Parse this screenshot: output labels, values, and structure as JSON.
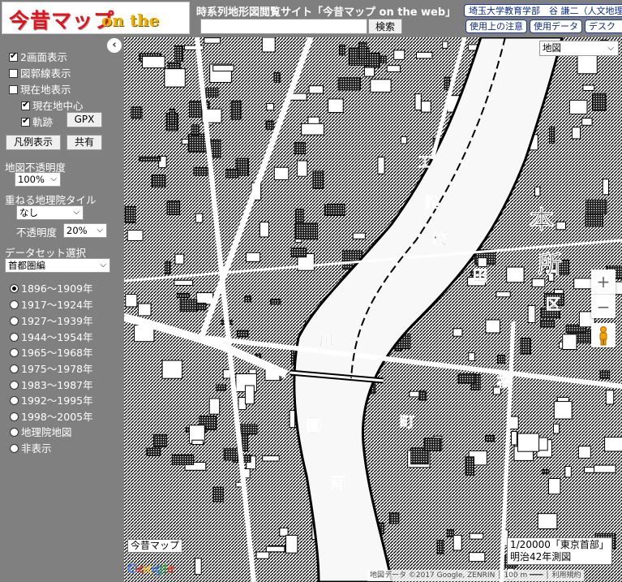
{
  "header": {
    "logo_jp": "今昔マップ",
    "logo_en": "on the web",
    "site_title": "時系列地形図閲覧サイト「今昔マップ on the web」",
    "search_placeholder": "",
    "search_button": "検索",
    "affiliation": "埼玉大学教育学部　谷 謙二（人文地理",
    "links": [
      "使用上の注意",
      "使用データ",
      "デスク"
    ]
  },
  "sidebar": {
    "collapse_icon": "chevron-left-icon",
    "checkboxes": [
      {
        "label": "2画面表示",
        "checked": true
      },
      {
        "label": "図郭線表示",
        "checked": false
      },
      {
        "label": "現在地表示",
        "checked": false
      },
      {
        "label": "現在地中心",
        "checked": true
      },
      {
        "label": "軌跡",
        "checked": true
      }
    ],
    "gpx_button": "GPX",
    "legend_button": "凡例表示",
    "share_button": "共有",
    "opacity_label": "地図不透明度",
    "opacity_value": "100%",
    "overlay_label": "重ねる地理院タイル",
    "overlay_value": "なし",
    "overlay_opacity_label": "不透明度",
    "overlay_opacity_value": "20%",
    "dataset_label": "データセット選択",
    "dataset_value": "首都圏編",
    "periods": [
      {
        "label": "1896～1909年",
        "checked": true
      },
      {
        "label": "1917～1924年",
        "checked": false
      },
      {
        "label": "1927～1939年",
        "checked": false
      },
      {
        "label": "1944～1954年",
        "checked": false
      },
      {
        "label": "1965～1968年",
        "checked": false
      },
      {
        "label": "1975～1978年",
        "checked": false
      },
      {
        "label": "1983～1987年",
        "checked": false
      },
      {
        "label": "1992～1995年",
        "checked": false
      },
      {
        "label": "1998～2005年",
        "checked": false
      },
      {
        "label": "地理院地図",
        "checked": false
      },
      {
        "label": "非表示",
        "checked": false
      }
    ]
  },
  "map": {
    "layer_select": "地図",
    "zoom_in": "+",
    "zoom_out": "−",
    "pegman_icon": "pegman-icon",
    "source_label": "今昔マップ",
    "google_logo": "Google",
    "scale_line1": "1/20000「東京首部」",
    "scale_line2": "明治42年測図",
    "attribution": "地図データ ©2017 Google, ZENRIN │ 100 m ━━━ │ 利用規約",
    "labels": [
      {
        "text": "工",
        "col": "#000"
      },
      {
        "text": "業",
        "col": "#000"
      },
      {
        "text": "校",
        "col": "#000"
      },
      {
        "text": "本",
        "col": "#000"
      },
      {
        "text": "所",
        "col": "#000"
      },
      {
        "text": "区",
        "col": "#000"
      },
      {
        "text": "町",
        "col": "#000"
      },
      {
        "text": "田",
        "col": "#000"
      },
      {
        "text": "両",
        "col": "#000"
      },
      {
        "text": "國",
        "col": "#000"
      },
      {
        "text": "川",
        "col": "#000"
      },
      {
        "text": "橋",
        "col": "#000"
      }
    ]
  }
}
